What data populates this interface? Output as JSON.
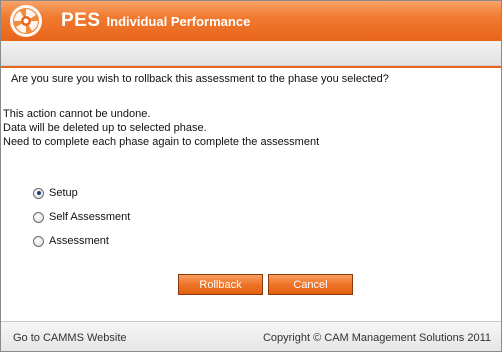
{
  "header": {
    "app_abbr": "PES",
    "app_name": "Individual Performance"
  },
  "dialog": {
    "question": "Are you sure you wish to rollback this assessment to the phase you selected?",
    "warnings": [
      "This action cannot be undone.",
      "Data will be deleted up to selected phase.",
      "Need to complete each phase again to complete the assessment"
    ],
    "phases": [
      {
        "label": "Setup",
        "checked": true
      },
      {
        "label": "Self Assessment",
        "checked": false
      },
      {
        "label": "Assessment",
        "checked": false
      }
    ],
    "rollback_label": "Rollback",
    "cancel_label": "Cancel"
  },
  "footer": {
    "link": "Go to CAMMS Website",
    "copyright": "Copyright © CAM Management Solutions 2011"
  },
  "colors": {
    "brand_orange": "#e8651a",
    "radio_dot": "#1f3f7a"
  },
  "icons": {
    "logo": "camms-swirl-logo-icon"
  }
}
